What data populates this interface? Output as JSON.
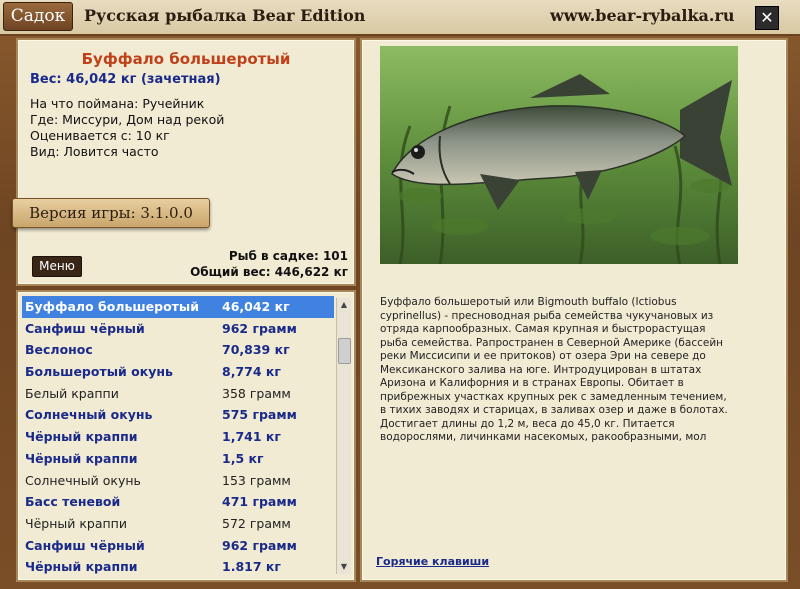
{
  "window": {
    "tab_label": "Садок",
    "title": "Русская рыбалка Bear Edition",
    "url": "www.bear-rybalka.ru",
    "close_glyph": "✕"
  },
  "fish": {
    "name": "Буффало большеротый",
    "weight_line": "Вес: 46,042 кг (зачетная)",
    "caught_on": "На что поймана: Ручейник",
    "where": "Где: Миссури, Дом над рекой",
    "valued_from": "Оценивается с: 10 кг",
    "kind": "Вид: Ловится часто",
    "description": "Буффало большеротый или Bigmouth buffalo (Ictiobus cyprinellus) - пресноводная рыба семейства чукучановых из отряда карпообразных. Самая крупная и быстрорастущая рыба семейства. Рапространен в Северной Америке (бассейн реки Миссисипи и ее притоков) от озера Эри на севере до Мексиканского залива на юге. Интродуцирован в штатах Аризона и Калифорния и в странах Европы. Обитает в прибрежных участках крупных рек с замедленным течением, в тихих заводях и старицах, в заливах озер и даже в болотах. Достигает длины до 1,2 м, веса до 45,0 кг. Питается водорослями, личинками насекомых, ракообразными, мол"
  },
  "version_label": "Версия игры: 3.1.0.0",
  "menu_label": "Меню",
  "stats": {
    "fish_count": "Рыб в садке: 101",
    "total_weight": "Общий вес: 446,622 кг"
  },
  "hotkeys_label": "Горячие клавиши",
  "catch_list": [
    {
      "name": "Буффало большеротый",
      "weight": "46,042 кг",
      "style": "sel"
    },
    {
      "name": "Санфиш чёрный",
      "weight": "962 грамм",
      "style": "bold"
    },
    {
      "name": "Веслонос",
      "weight": "70,839 кг",
      "style": "bold"
    },
    {
      "name": "Большеротый окунь",
      "weight": "8,774 кг",
      "style": "bold"
    },
    {
      "name": "Белый краппи",
      "weight": "358 грамм",
      "style": "plain"
    },
    {
      "name": "Солнечный окунь",
      "weight": "575 грамм",
      "style": "bold"
    },
    {
      "name": "Чёрный краппи",
      "weight": "1,741 кг",
      "style": "bold"
    },
    {
      "name": "Чёрный краппи",
      "weight": "1,5 кг",
      "style": "bold"
    },
    {
      "name": "Солнечный окунь",
      "weight": "153 грамм",
      "style": "plain"
    },
    {
      "name": "Басс теневой",
      "weight": "471 грамм",
      "style": "bold"
    },
    {
      "name": "Чёрный краппи",
      "weight": "572 грамм",
      "style": "plain"
    },
    {
      "name": "Санфиш чёрный",
      "weight": "962 грамм",
      "style": "bold"
    },
    {
      "name": "Чёрный краппи",
      "weight": "1.817 кг",
      "style": "bold"
    }
  ]
}
